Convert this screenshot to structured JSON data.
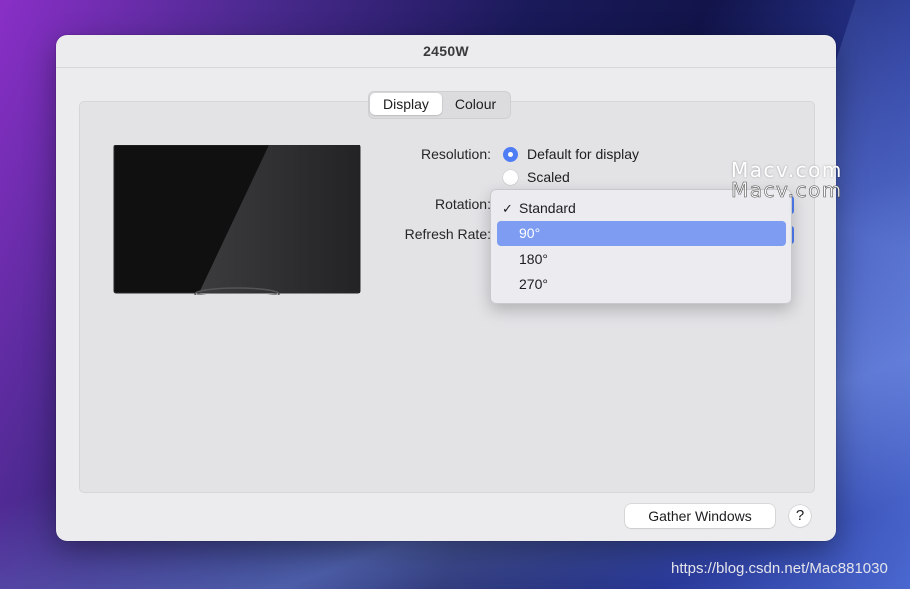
{
  "window": {
    "title": "2450W"
  },
  "tabs": [
    {
      "label": "Display",
      "active": true
    },
    {
      "label": "Colour",
      "active": false
    }
  ],
  "form": {
    "resolution_label": "Resolution:",
    "resolution_options": [
      {
        "label": "Default for display",
        "selected": true
      },
      {
        "label": "Scaled",
        "selected": false
      }
    ],
    "rotation_label": "Rotation:",
    "refresh_rate_label": "Refresh Rate:"
  },
  "rotation_menu": {
    "items": [
      {
        "label": "Standard",
        "checked": true,
        "highlighted": false
      },
      {
        "label": "90°",
        "checked": false,
        "highlighted": true
      },
      {
        "label": "180°",
        "checked": false,
        "highlighted": false
      },
      {
        "label": "270°",
        "checked": false,
        "highlighted": false
      }
    ],
    "checkmark": "✓"
  },
  "buttons": {
    "gather_windows": "Gather Windows",
    "help": "?"
  },
  "watermarks": {
    "macv_1": "Macv.com",
    "macv_2": "Macv.com",
    "url": "https://blog.csdn.net/Mac881030"
  },
  "colors": {
    "accent": "#4f7df5",
    "menu_highlight": "#7d9cf2",
    "window_bg": "#ececee"
  }
}
